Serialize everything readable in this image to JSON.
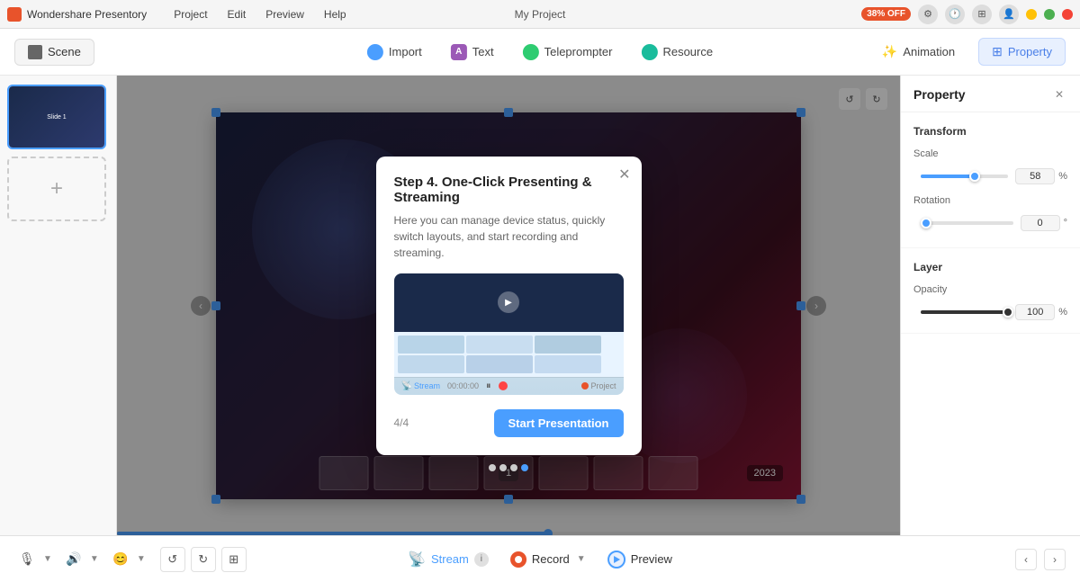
{
  "app": {
    "name": "Wondershare Presentory",
    "badge": "38% OFF",
    "project_name": "My Project"
  },
  "title_bar": {
    "menus": [
      "Project",
      "Edit",
      "Preview",
      "Help"
    ]
  },
  "toolbar": {
    "scene_label": "Scene",
    "import_label": "Import",
    "text_label": "Text",
    "teleprompter_label": "Teleprompter",
    "resource_label": "Resource",
    "animation_label": "Animation",
    "property_label": "Property"
  },
  "property_panel": {
    "title": "Property",
    "transform_label": "Transform",
    "scale_label": "Scale",
    "scale_value": "58",
    "scale_pct": "%",
    "rotation_label": "Rotation",
    "rotation_value": "0",
    "rotation_unit": "°",
    "layer_label": "Layer",
    "opacity_label": "Opacity",
    "opacity_value": "100",
    "opacity_pct": "%"
  },
  "modal": {
    "title": "Step 4. One-Click Presenting & Streaming",
    "description": "Here you can manage device status, quickly switch layouts, and start recording and streaming.",
    "page_indicator": "4/4",
    "cta_label": "Start Presentation",
    "stream_label": "Stream",
    "record_label": "Project",
    "dots": [
      false,
      false,
      false,
      true
    ]
  },
  "canvas": {
    "slide_number": "1",
    "timestamp": "2023",
    "progress_pct": 55
  },
  "bottom_toolbar": {
    "stream_label": "Stream",
    "record_label": "Record",
    "preview_label": "Preview"
  }
}
